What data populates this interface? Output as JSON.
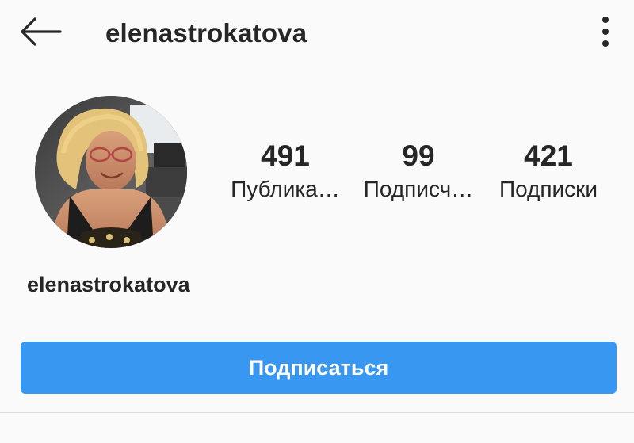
{
  "header": {
    "back_icon": "arrow-left-icon",
    "title": "elenastrokatova",
    "more_icon": "more-vertical-icon"
  },
  "profile": {
    "avatar_alt": "profile photo",
    "name": "elenastrokatova",
    "stats": [
      {
        "value": "491",
        "label": "Публика…"
      },
      {
        "value": "99",
        "label": "Подписч…"
      },
      {
        "value": "421",
        "label": "Подписки"
      }
    ],
    "follow_label": "Подписаться"
  },
  "colors": {
    "accent": "#3897f0",
    "background": "#fafafa",
    "text": "#262626",
    "divider": "#dbdbdb"
  }
}
